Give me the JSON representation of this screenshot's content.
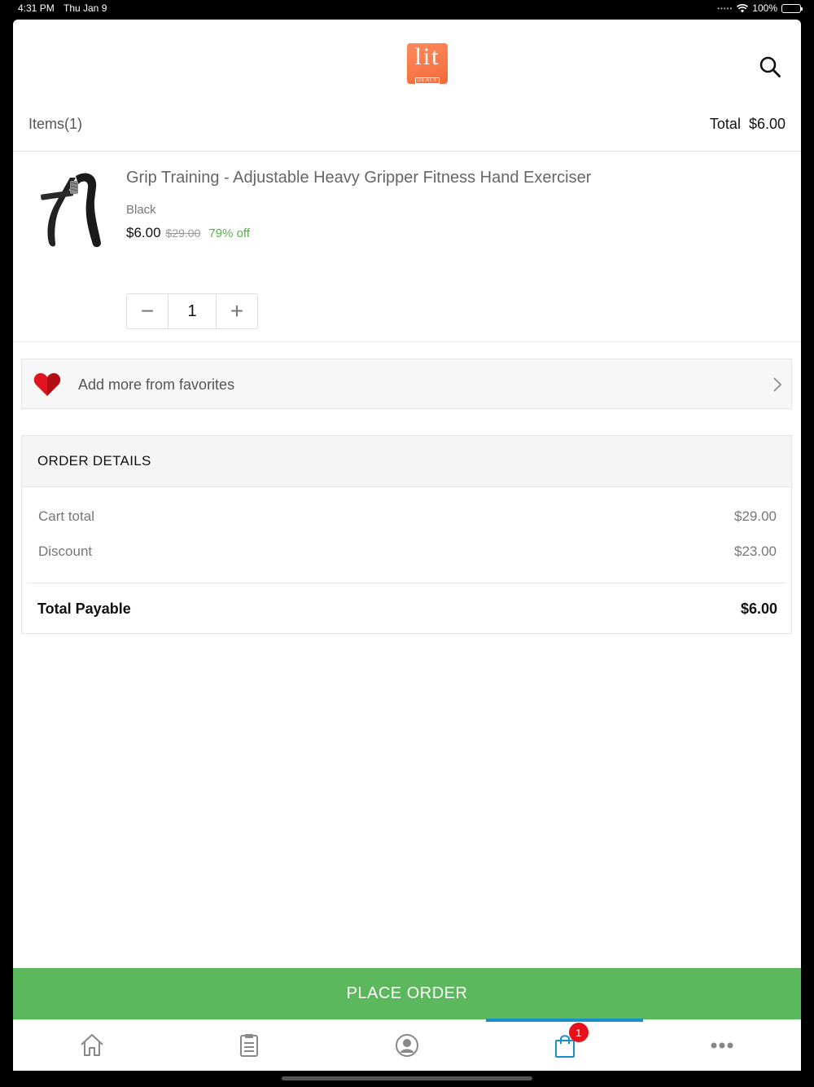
{
  "status_bar": {
    "time": "4:31 PM",
    "date": "Thu Jan 9",
    "battery": "100%"
  },
  "header": {
    "logo_text": "lit",
    "logo_subtext": "DEALS"
  },
  "cart": {
    "items_count_label": "Items(1)",
    "total_label": "Total  $6.00"
  },
  "product": {
    "title": "Grip Training - Adjustable Heavy Gripper Fitness Hand Exerciser",
    "variant": "Black",
    "price": "$6.00",
    "original_price": "$29.00",
    "discount": "79% off",
    "quantity": "1",
    "minus_symbol": "−",
    "plus_symbol": "+"
  },
  "favorites": {
    "label": "Add more from favorites"
  },
  "order_details": {
    "title": "ORDER DETAILS",
    "cart_total_label": "Cart total",
    "cart_total_value": "$29.00",
    "discount_label": "Discount",
    "discount_value": "$23.00",
    "total_payable_label": "Total Payable",
    "total_payable_value": "$6.00"
  },
  "place_order": {
    "label": "PLACE ORDER"
  },
  "tab_bar": {
    "tabs": [
      {
        "icon": "home-icon"
      },
      {
        "icon": "orders-icon"
      },
      {
        "icon": "account-icon"
      },
      {
        "icon": "bag-icon",
        "badge": "1",
        "active": true
      },
      {
        "icon": "more-icon"
      }
    ]
  },
  "colors": {
    "accent": "#5cb85c",
    "active_tab": "#1890c9",
    "badge": "#e8101a",
    "discount_text": "#58b04a",
    "logo": "#f46a3b"
  }
}
